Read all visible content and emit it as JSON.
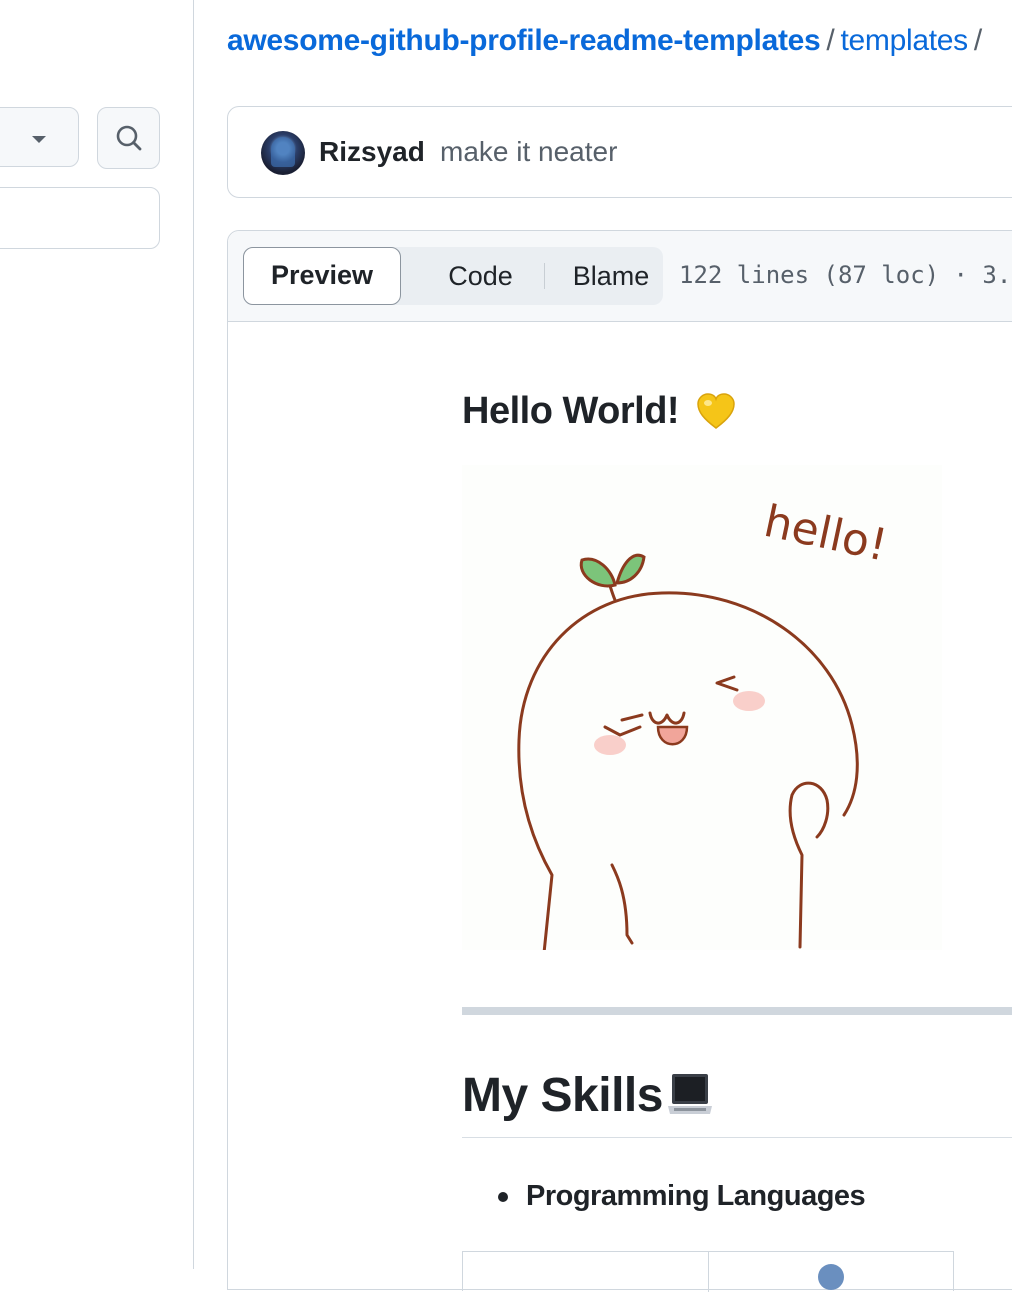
{
  "breadcrumb": {
    "repo": "awesome-github-profile-readme-templates",
    "separator": "/",
    "directory": "templates"
  },
  "commit": {
    "author": "Rizsyad",
    "message": "make it neater"
  },
  "file_header": {
    "tabs": [
      "Preview",
      "Code",
      "Blame"
    ],
    "active_tab": "Preview",
    "meta": "122 lines (87 loc) · 3."
  },
  "readme": {
    "greeting_heading": "Hello World!",
    "greeting_emoji": "yellow-heart-icon",
    "image_text": "hello!",
    "skills_heading": "My Skills",
    "skills_emoji": "laptop-icon",
    "list_items": [
      "Programming Languages"
    ]
  },
  "colors": {
    "link": "#0969da",
    "border": "#d0d7de",
    "muted_text": "#57606a",
    "heart": "#f5c518",
    "image_stroke": "#8b3a1e"
  }
}
